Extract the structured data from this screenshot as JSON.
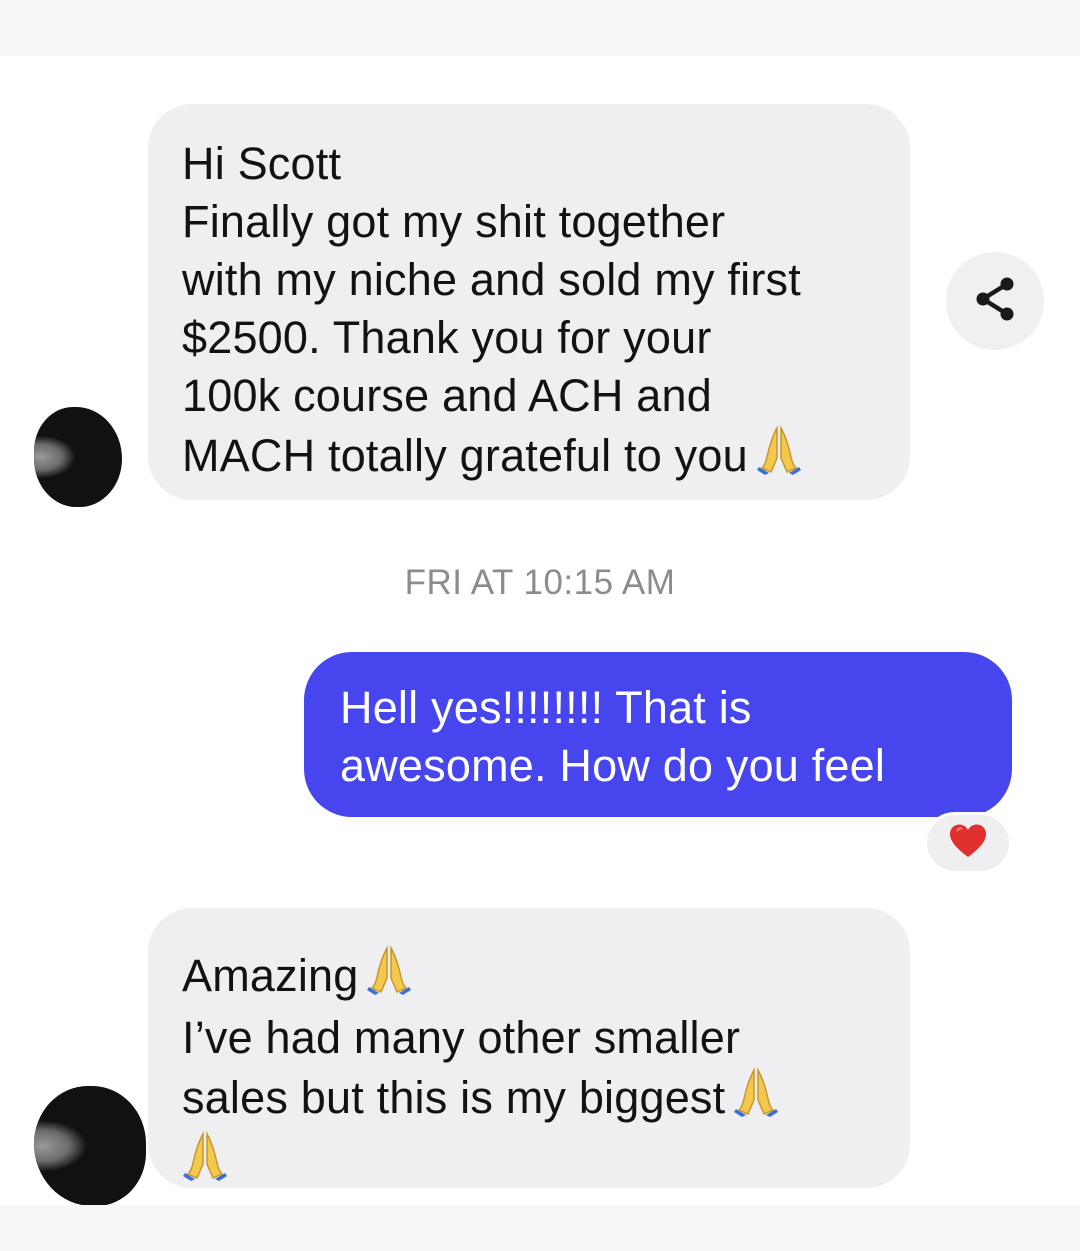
{
  "colors": {
    "incoming_bubble": "#efeff1",
    "outgoing_bubble": "#4645ee",
    "incoming_text": "#121212",
    "outgoing_text": "#ffffff",
    "timestamp_text": "#8c8c90",
    "reaction_heart": "#e0312f"
  },
  "messages": [
    {
      "direction": "incoming",
      "lines": [
        "Hi Scott",
        "Finally got my shit together",
        "with my niche and sold my first",
        "$2500. Thank you for your",
        "100k course and ACH and",
        "MACH totally grateful to you"
      ],
      "trailing_emoji": "folded-hands"
    },
    {
      "direction": "outgoing",
      "lines": [
        "Hell yes!!!!!!!! That is",
        "awesome. How do you feel"
      ],
      "reaction": "heart"
    },
    {
      "direction": "incoming",
      "lines": [
        "Amazing",
        "I’ve had many other smaller",
        "sales but this is my biggest"
      ],
      "emojis": [
        "folded-hands",
        "folded-hands",
        "folded-hands"
      ]
    }
  ],
  "timestamp": "FRI AT 10:15 AM",
  "icons": {
    "share": "share-icon",
    "reaction": "heart-icon",
    "emoji": "folded-hands-icon"
  }
}
